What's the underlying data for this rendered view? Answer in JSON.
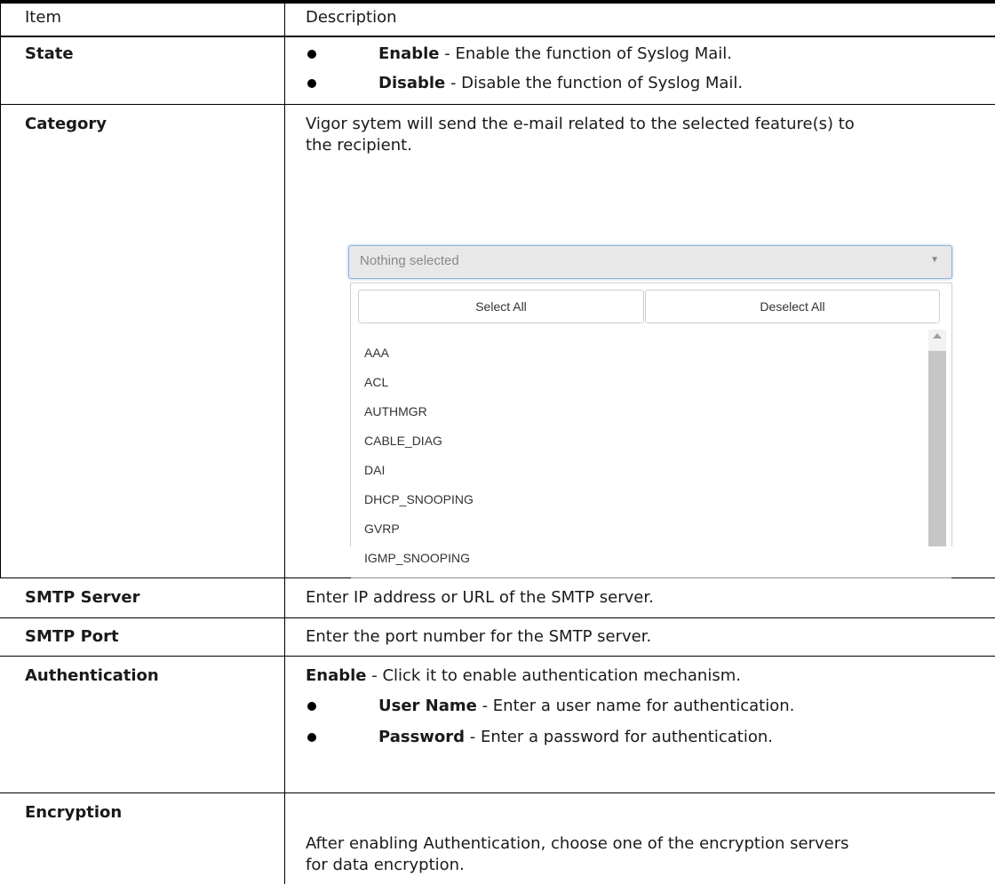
{
  "header": {
    "item": "Item",
    "description": "Description"
  },
  "rows": {
    "state": {
      "label": "State",
      "bullets": [
        {
          "term": "Enable",
          "text": " - Enable the function of Syslog Mail."
        },
        {
          "term": "Disable",
          "text": " - Disable the function of Syslog Mail."
        }
      ]
    },
    "category": {
      "label": "Category",
      "text": "Vigor sytem will send the e-mail related to the selected feature(s) to the recipient.",
      "widget": {
        "placeholder": "Nothing selected",
        "select_all": "Select All",
        "deselect_all": "Deselect All",
        "options": [
          "AAA",
          "ACL",
          "AUTHMGR",
          "CABLE_DIAG",
          "DAI",
          "DHCP_SNOOPING",
          "GVRP",
          "IGMP_SNOOPING"
        ]
      }
    },
    "smtp_server": {
      "label": "SMTP Server",
      "text": "Enter IP address or URL of the SMTP server."
    },
    "smtp_port": {
      "label": "SMTP Port",
      "text": "Enter the port number for the SMTP server."
    },
    "authentication": {
      "label": "Authentication",
      "intro_term": "Enable",
      "intro_text": " - Click it to enable authentication mechanism.",
      "bullets": [
        {
          "term": "User Name",
          "text": " - Enter a user name for authentication."
        },
        {
          "term": "Password",
          "text": " - Enter a password for authentication."
        }
      ]
    },
    "encryption": {
      "label": "Encryption",
      "text": "After enabling Authentication, choose one of the encryption servers for data encryption."
    }
  }
}
